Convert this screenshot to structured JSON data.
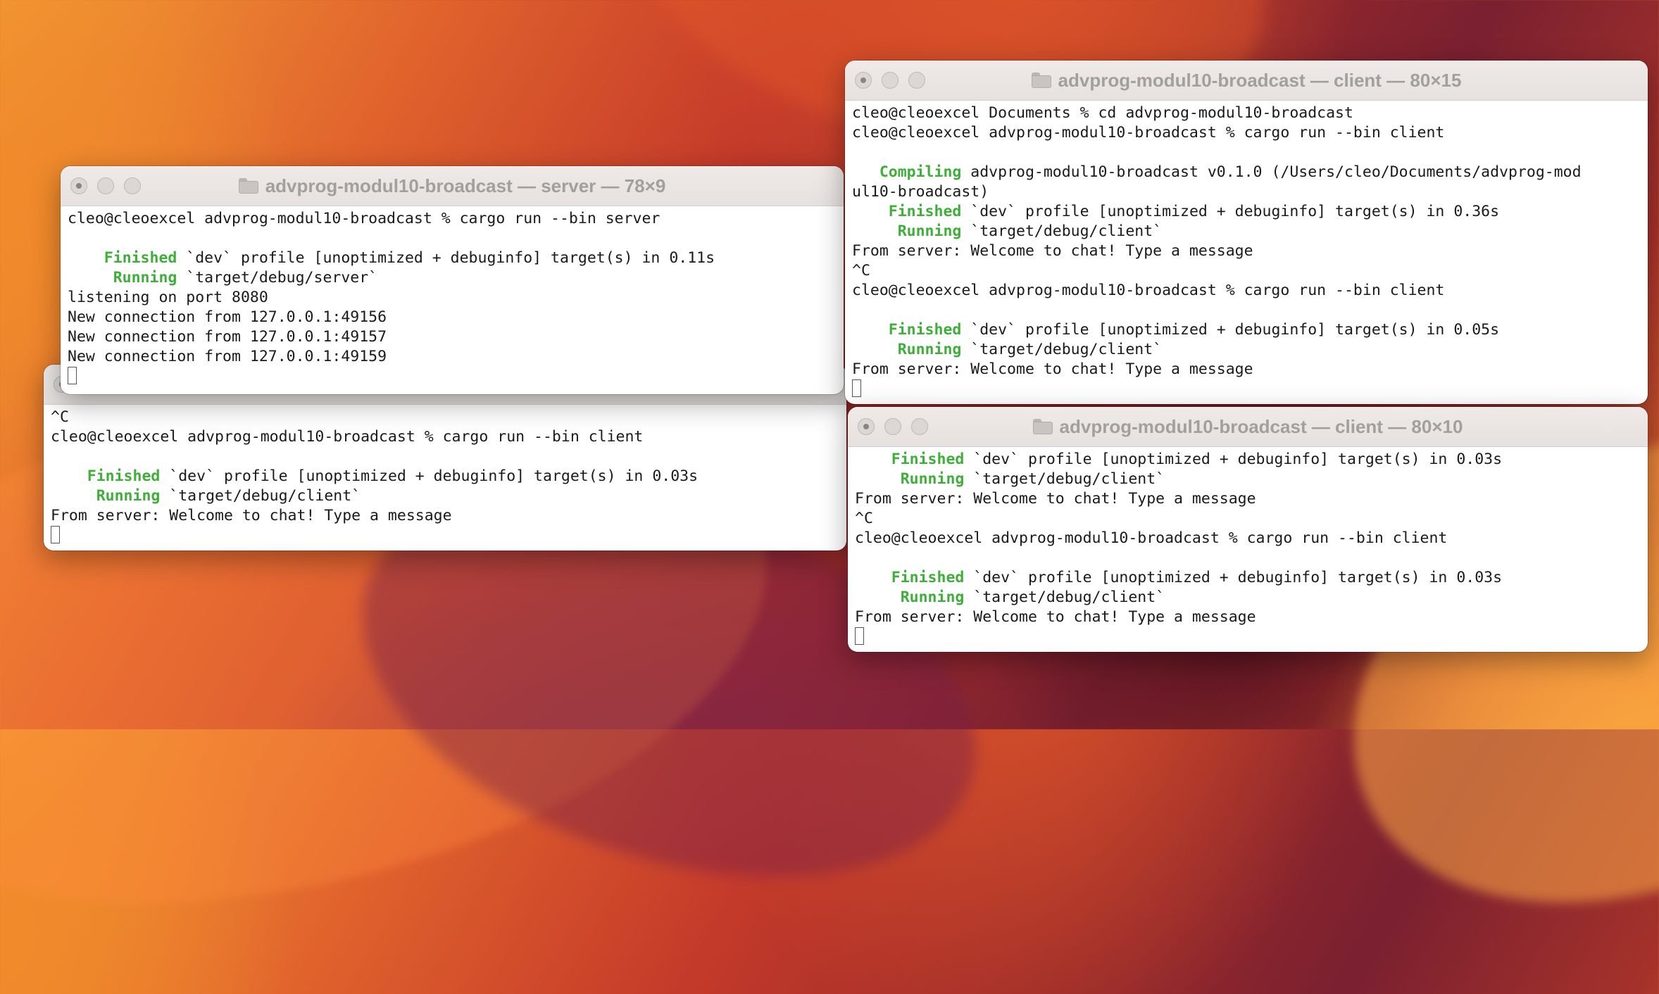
{
  "windows": {
    "client_top_right": {
      "title": "advprog-modul10-broadcast — client — 80×15",
      "lines": [
        {
          "text": "cleo@cleoexcel Documents % cd advprog-modul10-broadcast"
        },
        {
          "text": "cleo@cleoexcel advprog-modul10-broadcast % cargo run --bin client"
        },
        {
          "text": ""
        },
        {
          "prefix": "   Compiling",
          "text": " advprog-modul10-broadcast v0.1.0 (/Users/cleo/Documents/advprog-mod"
        },
        {
          "text": "ul10-broadcast)"
        },
        {
          "prefix": "    Finished",
          "text": " `dev` profile [unoptimized + debuginfo] target(s) in 0.36s"
        },
        {
          "prefix": "     Running",
          "text": " `target/debug/client`"
        },
        {
          "text": "From server: Welcome to chat! Type a message"
        },
        {
          "text": "^C"
        },
        {
          "text": "cleo@cleoexcel advprog-modul10-broadcast % cargo run --bin client"
        },
        {
          "text": ""
        },
        {
          "prefix": "    Finished",
          "text": " `dev` profile [unoptimized + debuginfo] target(s) in 0.05s"
        },
        {
          "prefix": "     Running",
          "text": " `target/debug/client`"
        },
        {
          "text": "From server: Welcome to chat! Type a message"
        }
      ]
    },
    "server": {
      "title": "advprog-modul10-broadcast — server — 78×9",
      "lines": [
        {
          "text": "cleo@cleoexcel advprog-modul10-broadcast % cargo run --bin server"
        },
        {
          "text": ""
        },
        {
          "prefix": "    Finished",
          "text": " `dev` profile [unoptimized + debuginfo] target(s) in 0.11s"
        },
        {
          "prefix": "     Running",
          "text": " `target/debug/server`"
        },
        {
          "text": "listening on port 8080"
        },
        {
          "text": "New connection from 127.0.0.1:49156"
        },
        {
          "text": "New connection from 127.0.0.1:49157"
        },
        {
          "text": "New connection from 127.0.0.1:49159"
        }
      ]
    },
    "client_left": {
      "title": "",
      "lines": [
        {
          "text": "^C"
        },
        {
          "text": "cleo@cleoexcel advprog-modul10-broadcast % cargo run --bin client"
        },
        {
          "text": ""
        },
        {
          "prefix": "    Finished",
          "text": " `dev` profile [unoptimized + debuginfo] target(s) in 0.03s"
        },
        {
          "prefix": "     Running",
          "text": " `target/debug/client`"
        },
        {
          "text": "From server: Welcome to chat! Type a message"
        }
      ]
    },
    "client_bottom_right": {
      "title": "advprog-modul10-broadcast — client — 80×10",
      "lines": [
        {
          "prefix": "    Finished",
          "text": " `dev` profile [unoptimized + debuginfo] target(s) in 0.03s"
        },
        {
          "prefix": "     Running",
          "text": " `target/debug/client`"
        },
        {
          "text": "From server: Welcome to chat! Type a message"
        },
        {
          "text": "^C"
        },
        {
          "text": "cleo@cleoexcel advprog-modul10-broadcast % cargo run --bin client"
        },
        {
          "text": ""
        },
        {
          "prefix": "    Finished",
          "text": " `dev` profile [unoptimized + debuginfo] target(s) in 0.03s"
        },
        {
          "prefix": "     Running",
          "text": " `target/debug/client`"
        },
        {
          "text": "From server: Welcome to chat! Type a message"
        }
      ]
    }
  },
  "colors": {
    "status_green": "#3fae3a",
    "title_text": "#a39f9d"
  },
  "icons": {
    "window_buttons": [
      "close-icon",
      "minimize-icon",
      "zoom-icon"
    ],
    "title_icon": "folder-icon"
  }
}
